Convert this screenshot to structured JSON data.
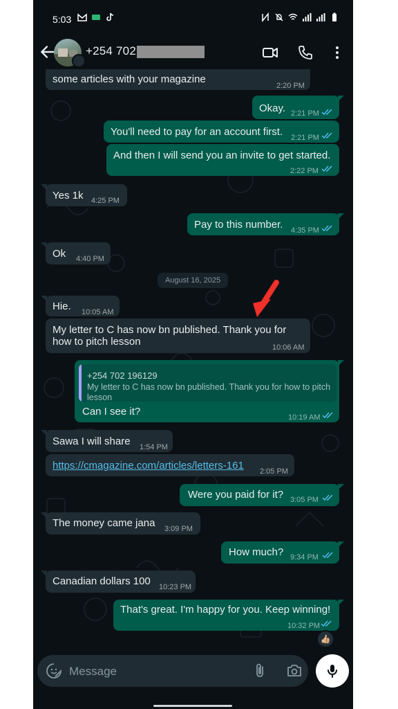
{
  "status_bar": {
    "time": "5:03"
  },
  "header": {
    "contact_name": "+254 702 1",
    "icons": [
      "back-arrow-icon",
      "video-call-icon",
      "phone-call-icon",
      "more-vert-icon"
    ]
  },
  "messages": [
    {
      "dir": "in",
      "text": "some articles with your magazine",
      "time": "2:20 PM"
    },
    {
      "dir": "out",
      "text": "Okay.",
      "time": "2:21 PM",
      "status": "read"
    },
    {
      "dir": "out",
      "text": "You'll need to pay for an account first.",
      "time": "2:21 PM",
      "status": "read"
    },
    {
      "dir": "out",
      "text": "And then I will send you an invite to get started.",
      "time": "2:22 PM",
      "status": "read"
    },
    {
      "dir": "in",
      "text": "Yes 1k",
      "time": "4:25 PM"
    },
    {
      "dir": "out",
      "text": "Pay to this number.",
      "time": "4:35 PM",
      "status": "read"
    },
    {
      "dir": "in",
      "text": "Ok",
      "time": "4:40 PM"
    },
    {
      "dir": "in",
      "text": "Hie.",
      "time": "10:05 AM"
    },
    {
      "dir": "in",
      "text_line1": "My letter to C has now bn published.  Thank you for",
      "text_line2": "how to pitch lesson",
      "time": "10:06 AM"
    },
    {
      "dir": "out",
      "quote_name": "+254 702 196129",
      "quote_text": "My letter to C has now bn published.  Thank you for how to pitch lesson",
      "text": "Can I see it?",
      "time": "10:19 AM",
      "status": "read"
    },
    {
      "dir": "in",
      "text": "Sawa I will share",
      "time": "1:54 PM"
    },
    {
      "dir": "in",
      "text": "https://cmagazine.com/articles/letters-161",
      "time": "2:05 PM",
      "is_link": true
    },
    {
      "dir": "out",
      "text": "Were you paid for it?",
      "time": "3:05 PM",
      "status": "read"
    },
    {
      "dir": "in",
      "text": "The money came jana",
      "time": "3:09 PM"
    },
    {
      "dir": "out",
      "text": "How much?",
      "time": "9:34 PM",
      "status": "read"
    },
    {
      "dir": "in",
      "text": "Canadian dollars 100",
      "time": "10:23 PM"
    },
    {
      "dir": "out",
      "text": "That's great. I'm happy for you. Keep winning!",
      "time": "10:32 PM",
      "status": "read",
      "reaction": "👍🏼"
    }
  ],
  "date_divider": "August 16, 2025",
  "input": {
    "placeholder": "Message"
  },
  "colors": {
    "background": "#0b1014",
    "incoming_bubble": "#202c33",
    "outgoing_bubble": "#005c4b",
    "read_ticks": "#53bdeb",
    "link": "#53bdeb",
    "annotation_arrow": "#f0302a"
  }
}
